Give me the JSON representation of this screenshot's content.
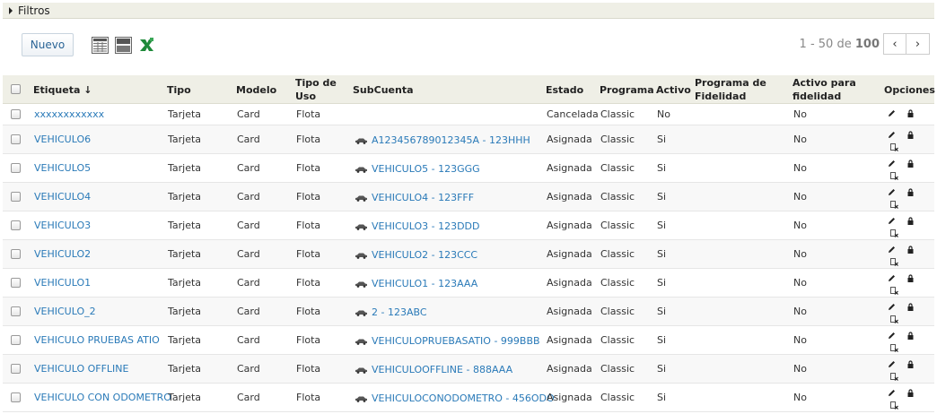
{
  "filters": {
    "label": "Filtros"
  },
  "toolbar": {
    "new_label": "Nuevo",
    "icons": [
      "grid-view-icon",
      "list-view-icon",
      "excel-export-icon"
    ]
  },
  "pagination": {
    "range": "1 - 50",
    "of": "de",
    "total": "100",
    "prev": "‹",
    "next": "›"
  },
  "table": {
    "columns": [
      {
        "key": "etiqueta",
        "label": "Etiqueta ↓"
      },
      {
        "key": "tipo",
        "label": "Tipo"
      },
      {
        "key": "modelo",
        "label": "Modelo"
      },
      {
        "key": "tipo_uso",
        "label": "Tipo de Uso"
      },
      {
        "key": "subcuenta",
        "label": "SubCuenta"
      },
      {
        "key": "estado",
        "label": "Estado"
      },
      {
        "key": "programa",
        "label": "Programa"
      },
      {
        "key": "activo",
        "label": "Activo"
      },
      {
        "key": "programa_fidelidad",
        "label": "Programa de Fidelidad"
      },
      {
        "key": "activo_fidelidad",
        "label": "Activo para fidelidad"
      },
      {
        "key": "opciones",
        "label": "Opciones"
      }
    ],
    "rows": [
      {
        "etiqueta": "xxxxxxxxxxxx",
        "tipo": "Tarjeta",
        "modelo": "Card",
        "tipo_uso": "Flota",
        "subcuenta": "",
        "estado": "Cancelada",
        "programa": "Classic",
        "activo": "No",
        "programa_fidelidad": "",
        "activo_fidelidad": "No"
      },
      {
        "etiqueta": "VEHICULO6",
        "tipo": "Tarjeta",
        "modelo": "Card",
        "tipo_uso": "Flota",
        "subcuenta": "A123456789012345A - 123HHH",
        "estado": "Asignada",
        "programa": "Classic",
        "activo": "Si",
        "programa_fidelidad": "",
        "activo_fidelidad": "No"
      },
      {
        "etiqueta": "VEHICULO5",
        "tipo": "Tarjeta",
        "modelo": "Card",
        "tipo_uso": "Flota",
        "subcuenta": "VEHICULO5 - 123GGG",
        "estado": "Asignada",
        "programa": "Classic",
        "activo": "Si",
        "programa_fidelidad": "",
        "activo_fidelidad": "No"
      },
      {
        "etiqueta": "VEHICULO4",
        "tipo": "Tarjeta",
        "modelo": "Card",
        "tipo_uso": "Flota",
        "subcuenta": "VEHICULO4 - 123FFF",
        "estado": "Asignada",
        "programa": "Classic",
        "activo": "Si",
        "programa_fidelidad": "",
        "activo_fidelidad": "No"
      },
      {
        "etiqueta": "VEHICULO3",
        "tipo": "Tarjeta",
        "modelo": "Card",
        "tipo_uso": "Flota",
        "subcuenta": "VEHICULO3 - 123DDD",
        "estado": "Asignada",
        "programa": "Classic",
        "activo": "Si",
        "programa_fidelidad": "",
        "activo_fidelidad": "No"
      },
      {
        "etiqueta": "VEHICULO2",
        "tipo": "Tarjeta",
        "modelo": "Card",
        "tipo_uso": "Flota",
        "subcuenta": "VEHICULO2 - 123CCC",
        "estado": "Asignada",
        "programa": "Classic",
        "activo": "Si",
        "programa_fidelidad": "",
        "activo_fidelidad": "No"
      },
      {
        "etiqueta": "VEHICULO1",
        "tipo": "Tarjeta",
        "modelo": "Card",
        "tipo_uso": "Flota",
        "subcuenta": "VEHICULO1 - 123AAA",
        "estado": "Asignada",
        "programa": "Classic",
        "activo": "Si",
        "programa_fidelidad": "",
        "activo_fidelidad": "No"
      },
      {
        "etiqueta": "VEHICULO_2",
        "tipo": "Tarjeta",
        "modelo": "Card",
        "tipo_uso": "Flota",
        "subcuenta": "2 - 123ABC",
        "estado": "Asignada",
        "programa": "Classic",
        "activo": "Si",
        "programa_fidelidad": "",
        "activo_fidelidad": "No"
      },
      {
        "etiqueta": "VEHICULO PRUEBAS ATIO",
        "tipo": "Tarjeta",
        "modelo": "Card",
        "tipo_uso": "Flota",
        "subcuenta": "VEHICULOPRUEBASATIO - 999BBB",
        "estado": "Asignada",
        "programa": "Classic",
        "activo": "Si",
        "programa_fidelidad": "",
        "activo_fidelidad": "No"
      },
      {
        "etiqueta": "VEHICULO OFFLINE",
        "tipo": "Tarjeta",
        "modelo": "Card",
        "tipo_uso": "Flota",
        "subcuenta": "VEHICULOOFFLINE - 888AAA",
        "estado": "Asignada",
        "programa": "Classic",
        "activo": "Si",
        "programa_fidelidad": "",
        "activo_fidelidad": "No"
      },
      {
        "etiqueta": "VEHICULO CON ODOMETRO",
        "tipo": "Tarjeta",
        "modelo": "Card",
        "tipo_uso": "Flota",
        "subcuenta": "VEHICULOCONODOMETRO - 456ODO",
        "estado": "Asignada",
        "programa": "Classic",
        "activo": "Si",
        "programa_fidelidad": "",
        "activo_fidelidad": "No"
      }
    ]
  },
  "colors": {
    "header_bg": "#efefe6",
    "link": "#2a7ab8",
    "excel_green": "#1f8a3a"
  }
}
